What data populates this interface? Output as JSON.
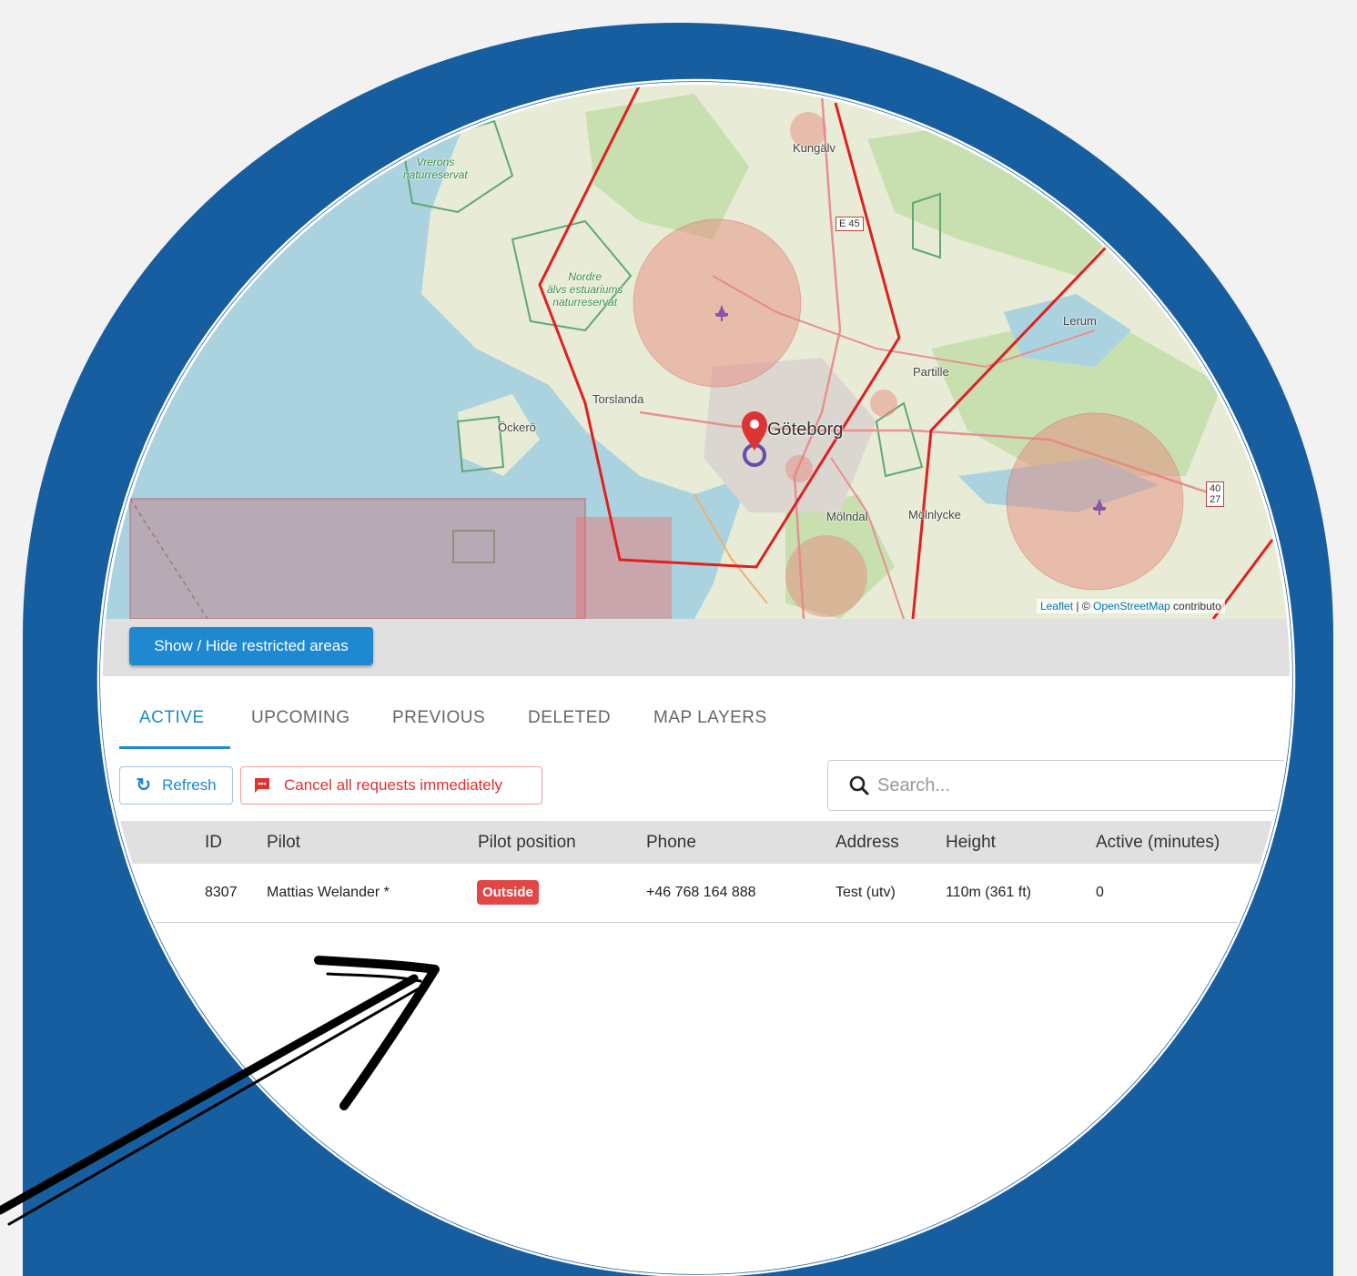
{
  "colors": {
    "frame_blue": "#175ea0",
    "accent": "#1e88d0",
    "danger": "#e04848",
    "restricted_line": "#e02020"
  },
  "map": {
    "places": {
      "kungalv": "Kungälv",
      "lerum": "Lerum",
      "partille": "Partille",
      "torslanda": "Torslanda",
      "ockero": "Öckerö",
      "goteborg": "Göteborg",
      "molndal": "Mölndal",
      "molnlycke": "Mölnlycke"
    },
    "reserves": {
      "nordre": "Nordre\nälvs estuariums\nnaturreservat",
      "vrerons": "Vrerons\nnaturreservat"
    },
    "roads": {
      "e45": "E 45",
      "r40": "40\n27"
    },
    "attribution": {
      "leaflet": "Leaflet",
      "separator": " | © ",
      "osm": "OpenStreetMap",
      "suffix": " contributo"
    },
    "icons": [
      "airport-icon",
      "location-pin-icon"
    ]
  },
  "toolbar": {
    "restricted_button": "Show / Hide restricted areas"
  },
  "tabs": [
    {
      "label": "ACTIVE",
      "active": true
    },
    {
      "label": "UPCOMING",
      "active": false
    },
    {
      "label": "PREVIOUS",
      "active": false
    },
    {
      "label": "DELETED",
      "active": false
    },
    {
      "label": "MAP LAYERS",
      "active": false
    }
  ],
  "actions": {
    "refresh": "Refresh",
    "cancel_all": "Cancel all requests immediately",
    "search_placeholder": "Search..."
  },
  "table": {
    "columns": [
      "ID",
      "Pilot",
      "Pilot position",
      "Phone",
      "Address",
      "Height",
      "Active (minutes)"
    ],
    "rows": [
      {
        "id": "8307",
        "pilot": "Mattias Welander *",
        "position": "Outside",
        "phone": "+46 768 164 888",
        "address": "Test (utv)",
        "height": "110m (361 ft)",
        "active_minutes": "0"
      }
    ]
  }
}
